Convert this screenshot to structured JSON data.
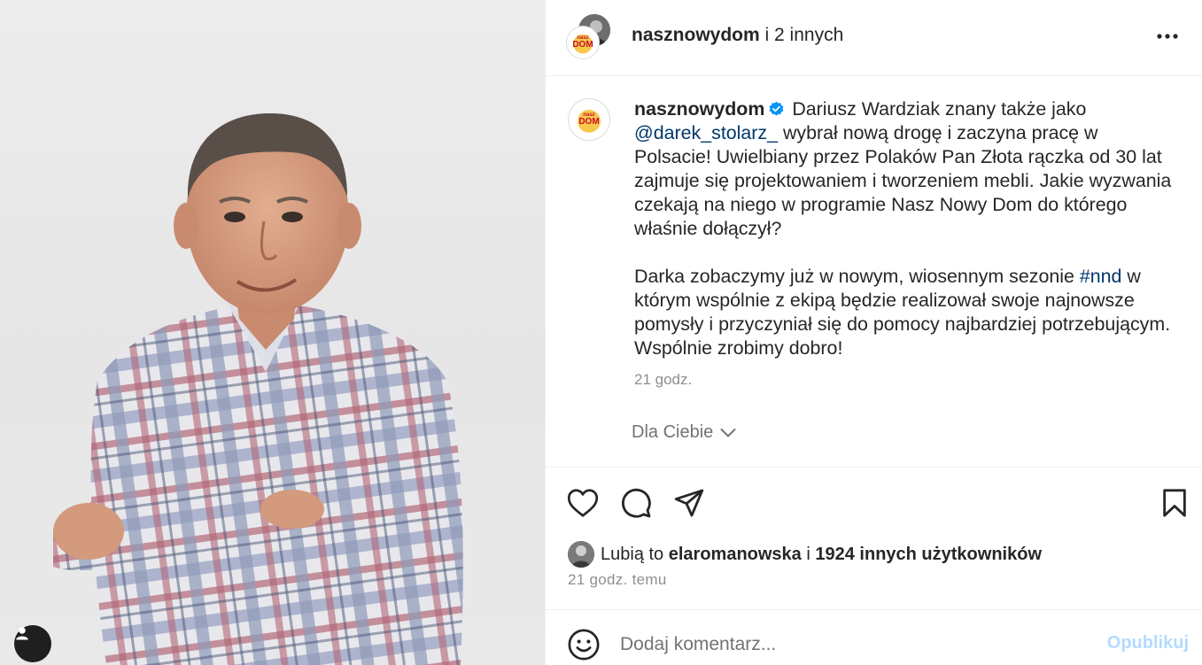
{
  "post": {
    "header": {
      "primary_user": "nasznowydom",
      "others_text": "i 2 innych",
      "logo_text_top": "nasz",
      "logo_text_bottom": "DOM",
      "more_icon": "ellipsis-icon"
    },
    "caption": {
      "username": "nasznowydom",
      "verified": true,
      "text_1": " Dariusz Wardziak znany także jako ",
      "mention": "@darek_stolarz_",
      "text_2": " wybrał nową drogę i zaczyna pracę w Polsacie! Uwielbiany przez Polaków Pan Złota rączka od 30 lat zajmuje się projektowaniem i tworzeniem mebli. Jakie wyzwania czekają na niego w programie Nasz Nowy Dom do którego właśnie dołączył?",
      "text_3": "Darka zobaczymy już w nowym, wiosennym sezonie ",
      "hashtag": "#nnd",
      "text_4": " w którym wspólnie z ekipą będzie realizował swoje najnowsze pomysły i przyczyniał się do pomocy najbardziej potrzebującym. Wspólnie zrobimy dobro!",
      "time": "21 godz."
    },
    "audience_selector": "Dla Ciebie",
    "likes": {
      "prefix": "Lubią to ",
      "user": "elaromanowska",
      "middle": " i ",
      "count_text": "1924 innych użytkowników"
    },
    "posted_ago": "21 godz. temu",
    "comment": {
      "placeholder": "Dodaj komentarz...",
      "publish_label": "Opublikuj"
    }
  },
  "colors": {
    "link": "#00376b",
    "verified": "#0095f6",
    "muted": "#8e8e8e",
    "publish_disabled": "#b3dbff"
  }
}
